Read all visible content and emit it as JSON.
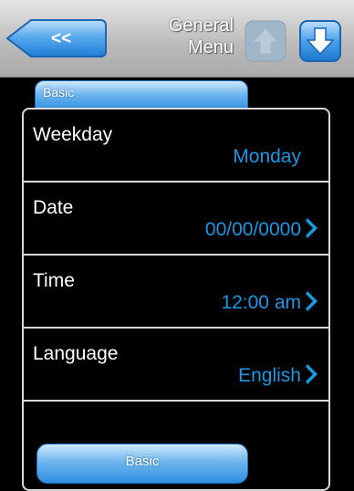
{
  "header": {
    "back_label": "<<",
    "title_line1": "General",
    "title_line2": "Menu",
    "up_icon": "arrow-up-icon",
    "down_icon": "arrow-down-icon"
  },
  "tab": {
    "label": "Basic"
  },
  "rows": [
    {
      "label": "Weekday",
      "value": "Monday",
      "has_arrow": false
    },
    {
      "label": "Date",
      "value": "00/00/0000",
      "has_arrow": true
    },
    {
      "label": "Time",
      "value": "12:00 am",
      "has_arrow": true
    },
    {
      "label": "Language",
      "value": "English",
      "has_arrow": true
    }
  ],
  "bottom_button": {
    "label": "Basic"
  },
  "colors": {
    "accent_blue": "#1c97e4",
    "header_gray": "#bdbdbd"
  }
}
